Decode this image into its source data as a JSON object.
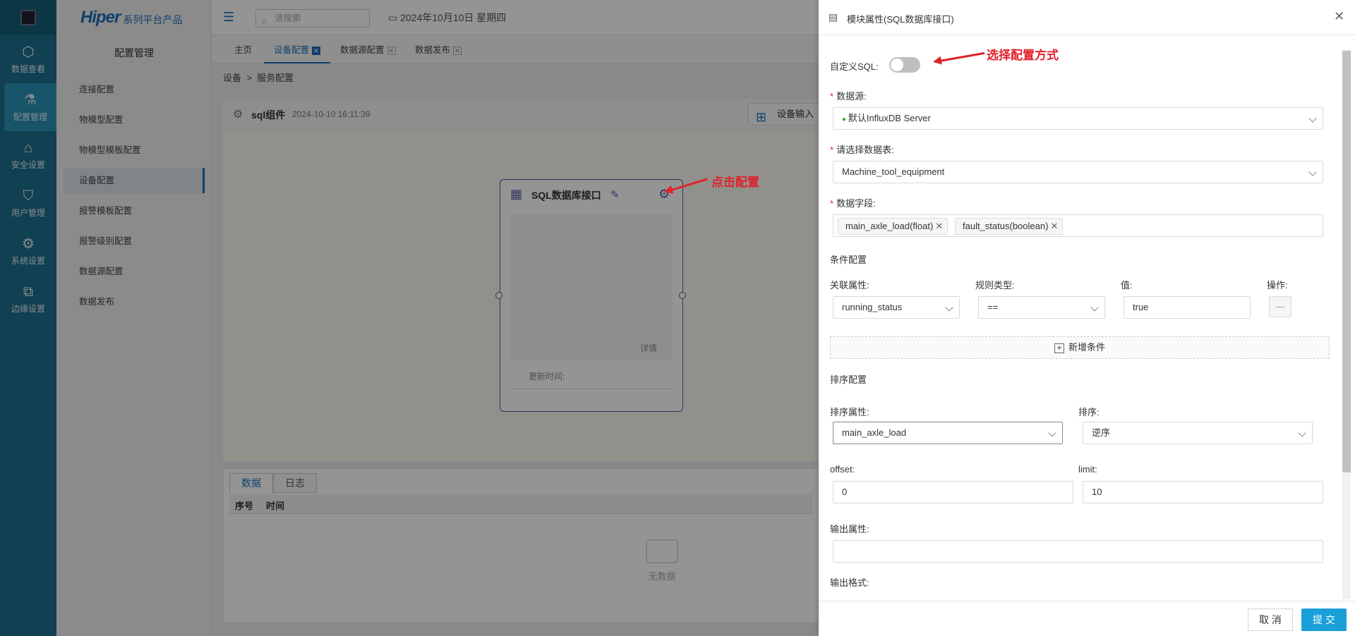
{
  "nav": {
    "items": [
      {
        "label": "数据查看",
        "icon": "cube-icon"
      },
      {
        "label": "配置管理",
        "icon": "flask-icon"
      },
      {
        "label": "安全设置",
        "icon": "house-lock-icon"
      },
      {
        "label": "用户管理",
        "icon": "shield-user-icon"
      },
      {
        "label": "系统设置",
        "icon": "settings-panel-icon"
      },
      {
        "label": "边缘设置",
        "icon": "network-icon"
      }
    ]
  },
  "sidebar": {
    "brand": "Hiper",
    "brand_sub": "系列平台产品",
    "title": "配置管理",
    "items": [
      "连接配置",
      "物模型配置",
      "物模型模板配置",
      "设备配置",
      "报警模板配置",
      "报警级别配置",
      "数据源配置",
      "数据发布"
    ]
  },
  "topbar": {
    "search_placeholder": "请搜索",
    "date": "2024年10月10日 星期四"
  },
  "tabs": [
    "主页",
    "设备配置",
    "数据源配置",
    "数据发布"
  ],
  "breadcrumb": {
    "a": "设备",
    "sep": ">",
    "b": "服务配置"
  },
  "card": {
    "name": "sql组件",
    "time": "2024-10-10 16:11:39",
    "button": "设备输入"
  },
  "node": {
    "title": "SQL数据库接口",
    "detail": "详情",
    "updated": "更新时间:"
  },
  "bottom": {
    "tabs": [
      "数据",
      "日志"
    ],
    "col1": "序号",
    "col2": "时间",
    "empty": "无数据"
  },
  "annotations": {
    "config_mode": "选择配置方式",
    "click_config": "点击配置"
  },
  "drawer": {
    "title": "模块属性(SQL数据库接口)",
    "custom_sql_label": "自定义SQL:",
    "datasource_label": "数据源:",
    "datasource_value": "默认InfluxDB Server",
    "table_label": "请选择数据表:",
    "table_value": "Machine_tool_equipment",
    "fields_label": "数据字段:",
    "fields": [
      "main_axle_load(float)",
      "fault_status(boolean)"
    ],
    "cond_section": "条件配置",
    "cond_attr_label": "关联属性:",
    "cond_rule_label": "规则类型:",
    "cond_value_label": "值:",
    "cond_op_label": "操作:",
    "cond_attr": "running_status",
    "cond_rule": "==",
    "cond_value": "true",
    "cond_op": "—",
    "add_condition": "新增条件",
    "sort_section": "排序配置",
    "sort_attr_label": "排序属性:",
    "sort_label": "排序:",
    "sort_attr": "main_axle_load",
    "sort_order": "逆序",
    "offset_label": "offset:",
    "offset": "0",
    "limit_label": "limit:",
    "limit": "10",
    "output_attr_label": "输出属性:",
    "output_attr": "",
    "output_format_label": "输出格式:"
  },
  "footer": {
    "cancel": "取 消",
    "submit": "提 交"
  },
  "colors": {
    "nav": "#1d6f8c",
    "accent": "#1d6fb8",
    "submit": "#1aa0d8",
    "annotation": "#e0222b"
  }
}
